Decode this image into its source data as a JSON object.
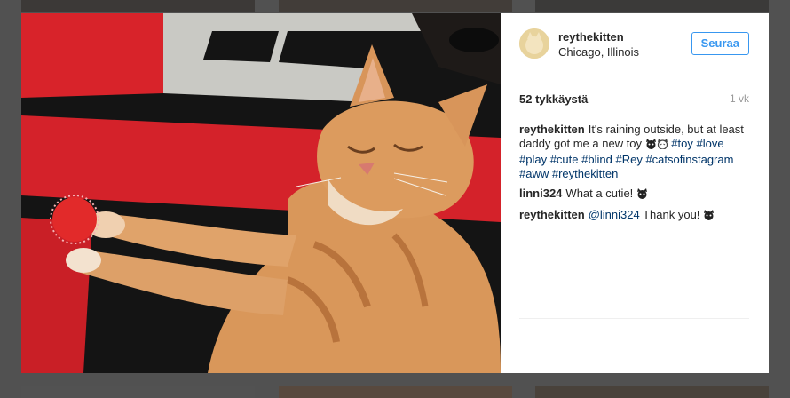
{
  "post": {
    "username": "reythekitten",
    "location": "Chicago, Illinois",
    "follow_label": "Seuraa",
    "likes": "52 tykkäystä",
    "time": "1 vk"
  },
  "caption": {
    "username": "reythekitten",
    "text": "It's raining outside, but at least daddy got me a new toy",
    "emojis": [
      "cat-face-icon",
      "cat-face-icon"
    ],
    "hashtags": [
      "#toy",
      "#love",
      "#play",
      "#cute",
      "#blind",
      "#Rey",
      "#catsofinstagram",
      "#aww",
      "#reythekitten"
    ]
  },
  "comments": [
    {
      "username": "linni324",
      "text": "What a cutie!",
      "emoji": "cat-face-icon"
    },
    {
      "username": "reythekitten",
      "mention": "@linni324",
      "text": "Thank you!",
      "emoji": "cat-face-icon"
    }
  ]
}
